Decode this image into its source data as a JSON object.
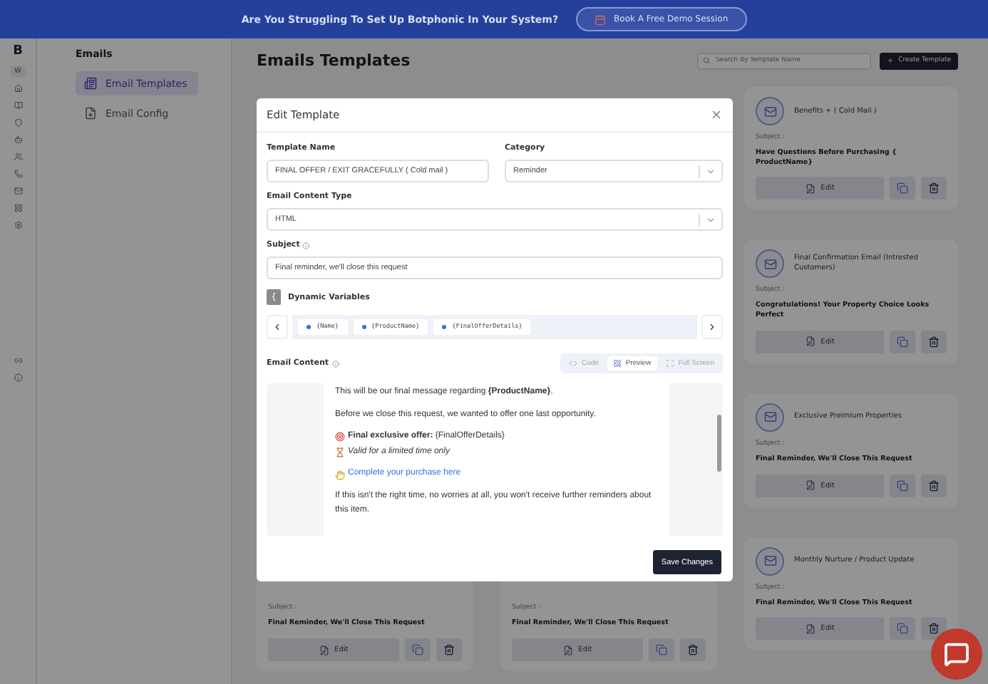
{
  "banner": {
    "text": "Are You Struggling To Set Up Botphonic In Your System?",
    "button": "Book A Free Demo Session"
  },
  "rail": {
    "logo": "B",
    "badge": "W"
  },
  "sidebar": {
    "heading": "Emails",
    "items": [
      {
        "label": "Email Templates",
        "selected": true,
        "kind": "templates"
      },
      {
        "label": "Email Config",
        "selected": false,
        "kind": "config"
      }
    ]
  },
  "page": {
    "title": "Emails Templates",
    "search": {
      "placeholder": "Search By Template Name"
    },
    "create_button": "Create Template"
  },
  "columns": [
    {
      "cards": [
        {
          "subject_label": "Subject :",
          "subject": "Final Reminder, We'll Close This Request",
          "edit": "Edit"
        }
      ]
    },
    {
      "cards": [
        {
          "subject_label": "Subject :",
          "subject": "Final Reminder, We'll Close This Request",
          "edit": "Edit"
        }
      ]
    },
    {
      "cards": [
        {
          "title": "Benefits + ( Cold Mail )",
          "subject_label": "Subject :",
          "subject": "Have Questions Before Purchasing { ProductName}",
          "edit": "Edit"
        },
        {
          "title": "Final Confirmation Email (Intrested Customers)",
          "subject_label": "Subject :",
          "subject": "Congratulations! Your Property Choice Looks Perfect",
          "edit": "Edit"
        },
        {
          "title": "Exclusive Preimium Properties",
          "subject_label": "Subject :",
          "subject": "Final Reminder, We'll Close This Request",
          "edit": "Edit"
        },
        {
          "title": "Monthly Nurture / Product Update",
          "subject_label": "Subject :",
          "subject": "Final Reminder, We'll Close This Request",
          "edit": "Edit"
        }
      ]
    }
  ],
  "modal": {
    "title": "Edit Template",
    "template_name": {
      "label": "Template Name",
      "value": "FINAL OFFER / EXIT GRACEFULLY ( Cold mail )"
    },
    "category": {
      "label": "Category",
      "value": "Reminder"
    },
    "content_type": {
      "label": "Email Content Type",
      "value": "HTML"
    },
    "subject": {
      "label": "Subject",
      "value": "Final reminder, we'll close this request"
    },
    "dynamic_variables": {
      "icon_text": "{",
      "label": "Dynamic Variables",
      "chips": [
        "{Name}",
        "{ProductName}",
        "{FinalOfferDetails}"
      ]
    },
    "email_content": {
      "label": "Email Content",
      "tabs": [
        {
          "label": "Code",
          "kind": "code",
          "selected": false
        },
        {
          "label": "Preview",
          "kind": "preview",
          "selected": true
        },
        {
          "label": "Full Screen",
          "kind": "fullscreen",
          "selected": false
        }
      ],
      "preview": [
        {
          "kind": "text",
          "text": "This will be our final message regarding **{ProductName}**."
        },
        {
          "kind": "text",
          "text": "Before we close this request, we wanted to offer one last opportunity."
        },
        {
          "kind": "offer",
          "text": "**Final exclusive offer:** {FinalOfferDetails}"
        },
        {
          "kind": "note",
          "text": "Valid for a limited time only"
        },
        {
          "kind": "link",
          "text": "Complete your purchase here"
        },
        {
          "kind": "text",
          "text": "If this isn't the right time, no worries at all, you won't receive further reminders about this item."
        }
      ]
    },
    "save_button": "Save Changes"
  }
}
